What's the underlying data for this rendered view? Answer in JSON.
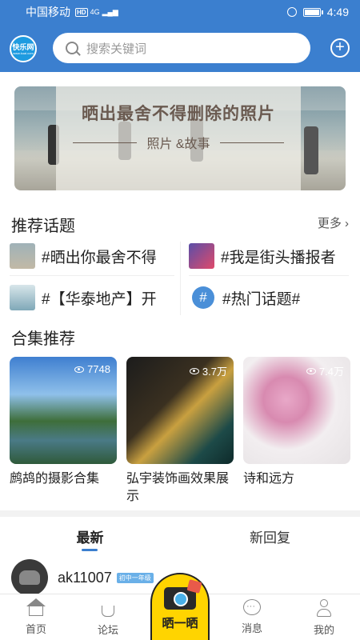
{
  "status_bar": {
    "carrier": "中国移动",
    "hd": "HD",
    "net": "4G",
    "time": "4:49"
  },
  "header": {
    "logo_text": "快乐网",
    "logo_sub": "www.kuai.com",
    "search_placeholder": "搜索关键词",
    "add_symbol": "+"
  },
  "banner": {
    "title": "晒出最舍不得删除的照片",
    "subtitle": "照片 &故事"
  },
  "topics": {
    "heading": "推荐话题",
    "more": "更多",
    "items": [
      {
        "label": "#晒出你最舍不得"
      },
      {
        "label": "#我是街头播报者"
      },
      {
        "label": "#【华泰地产】开"
      },
      {
        "label": "#热门话题#"
      }
    ],
    "hash_icon": "#"
  },
  "collections": {
    "heading": "合集推荐",
    "items": [
      {
        "title": "鹧鸪的摄影合集",
        "views": "7748"
      },
      {
        "title": "弘宇装饰画效果展示",
        "views": "3.7万"
      },
      {
        "title": "诗和远方",
        "views": "7.4万"
      }
    ]
  },
  "feed_tabs": {
    "latest": "最新",
    "new_replies": "新回复"
  },
  "post": {
    "username": "ak11007",
    "badge": "初中一年级"
  },
  "bottom_nav": {
    "home": "首页",
    "forum": "论坛",
    "share": "晒一晒",
    "messages": "消息",
    "mine": "我的"
  },
  "colors": {
    "brand_blue": "#3b7fcf",
    "share_yellow": "#ffd400"
  }
}
